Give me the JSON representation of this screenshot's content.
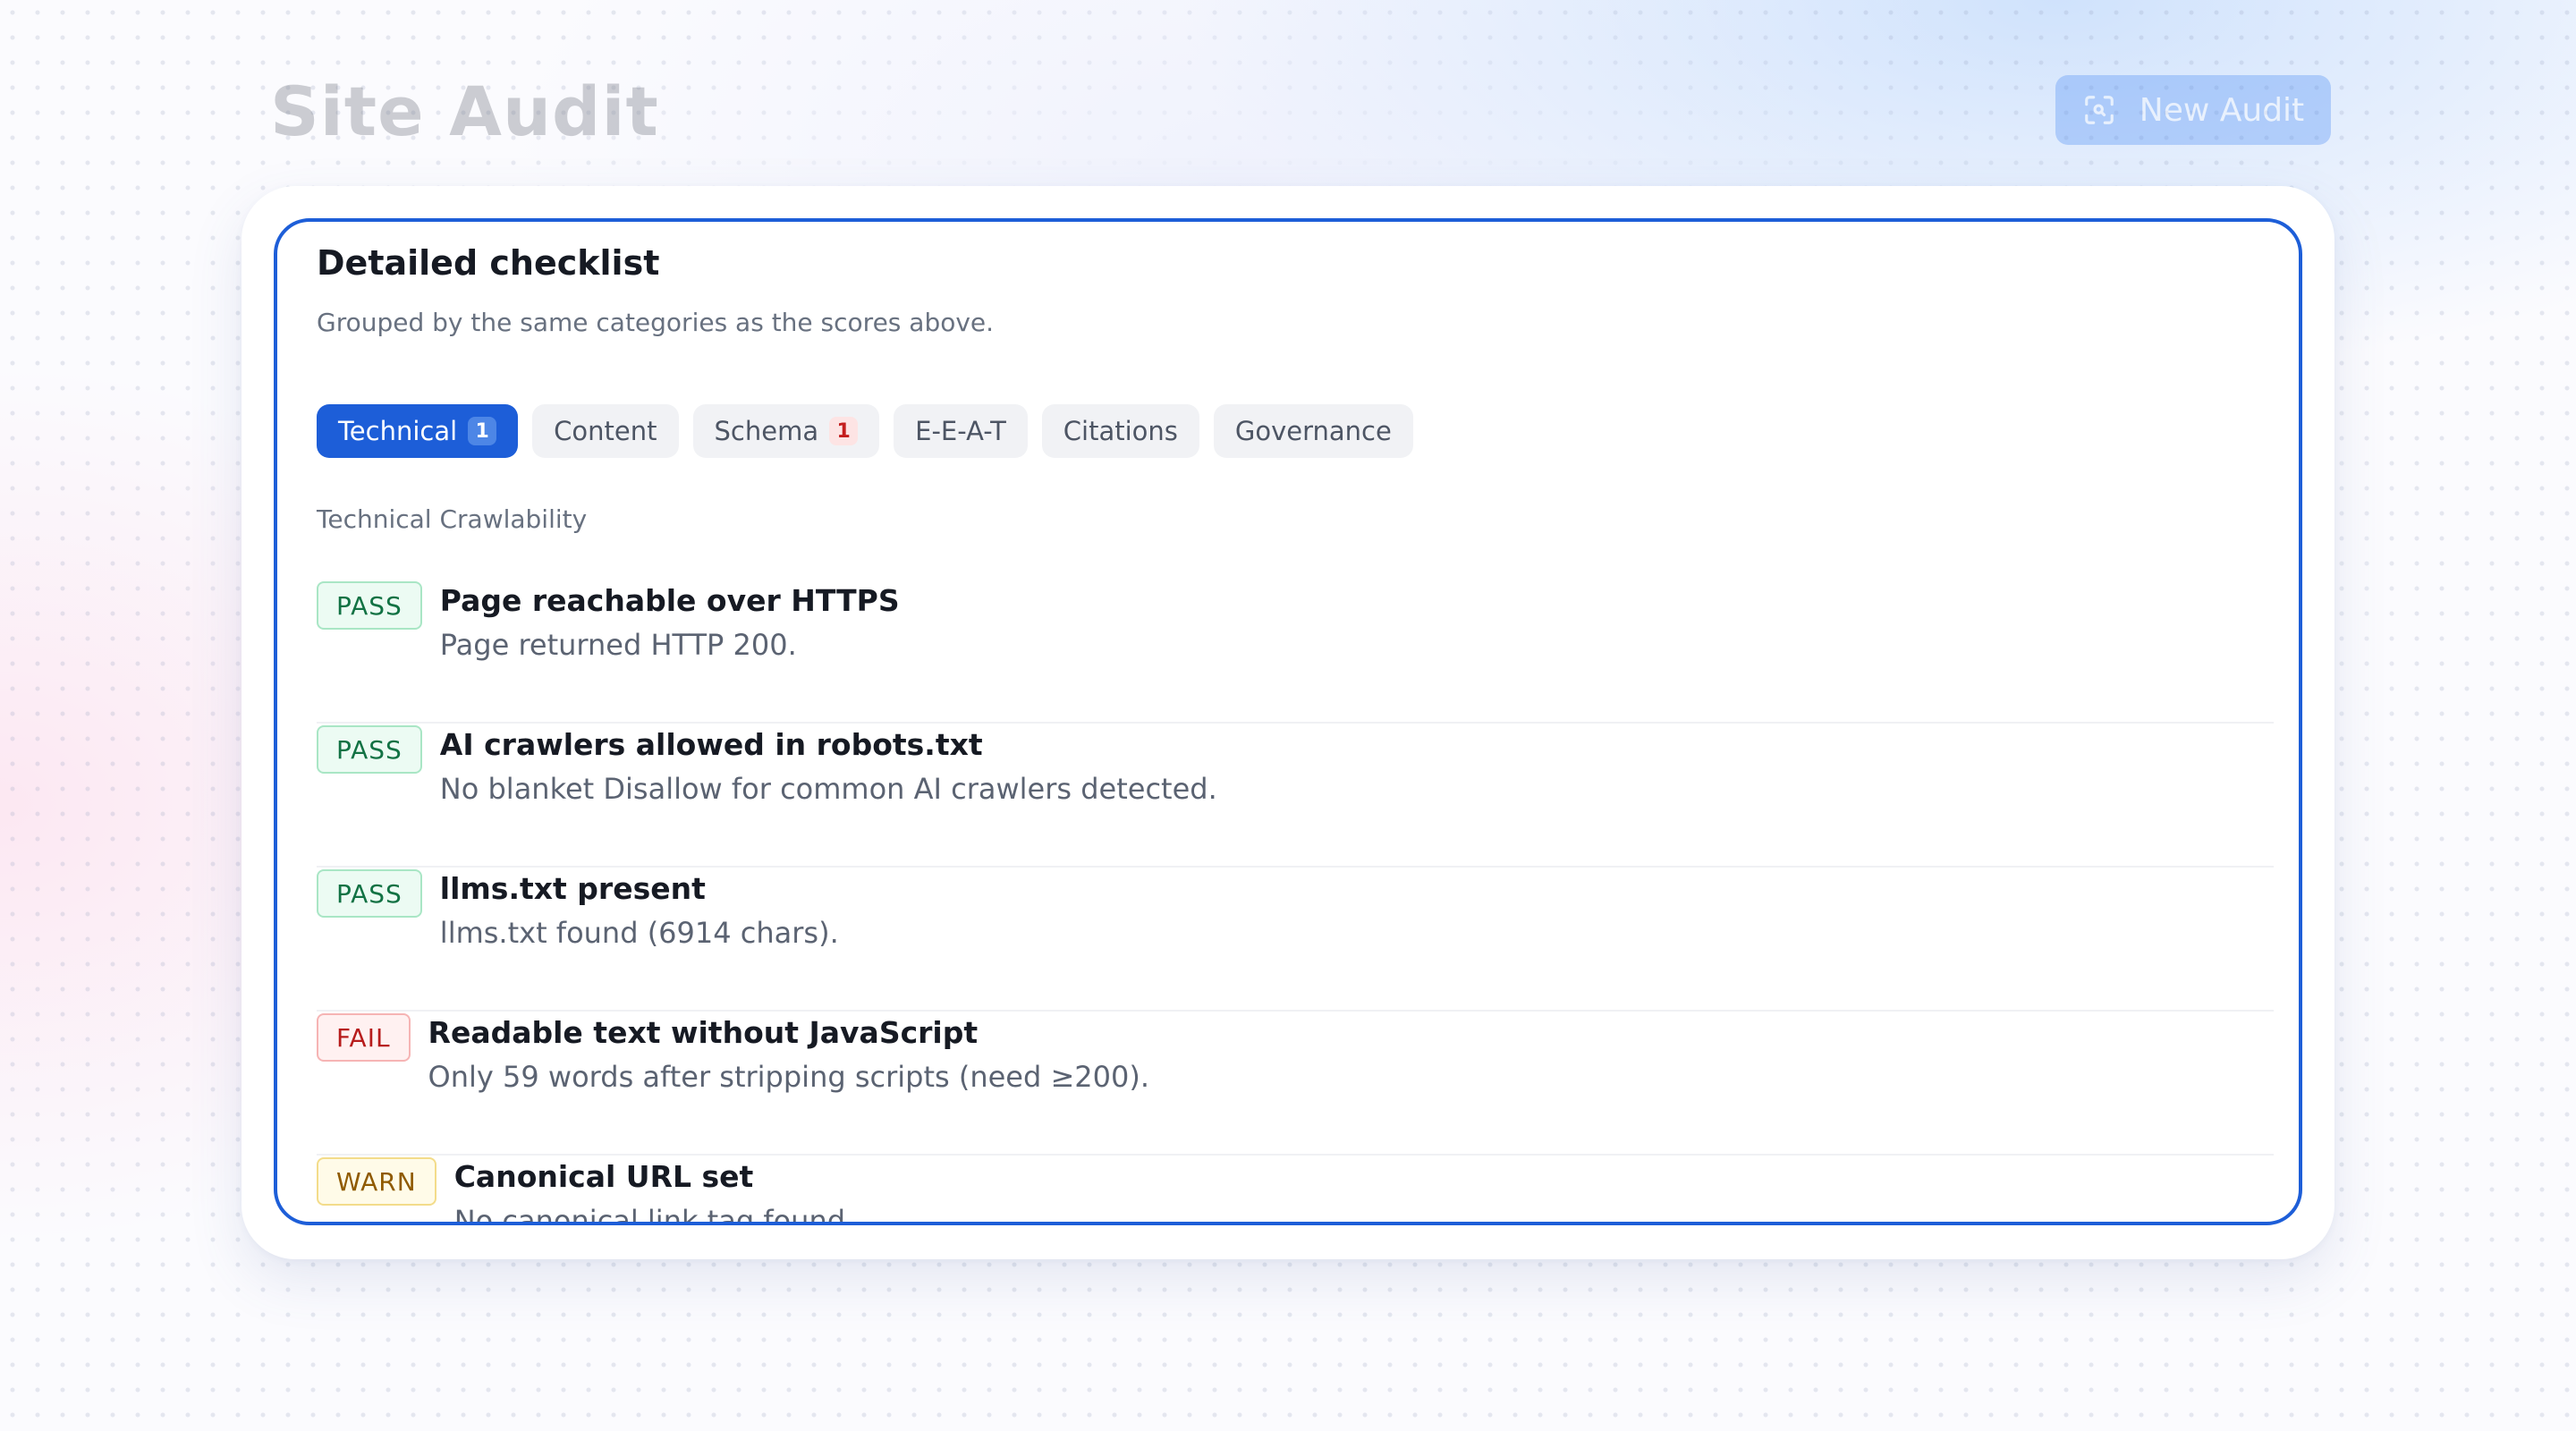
{
  "page": {
    "title": "Site Audit",
    "new_audit_label": "New Audit"
  },
  "checklist": {
    "title": "Detailed checklist",
    "subtitle": "Grouped by the same categories as the scores above.",
    "tabs": [
      {
        "label": "Technical",
        "badge": "1",
        "active": true
      },
      {
        "label": "Content",
        "badge": "",
        "active": false
      },
      {
        "label": "Schema",
        "badge": "1",
        "active": false
      },
      {
        "label": "E-E-A-T",
        "badge": "",
        "active": false
      },
      {
        "label": "Citations",
        "badge": "",
        "active": false
      },
      {
        "label": "Governance",
        "badge": "",
        "active": false
      }
    ],
    "section_label": "Technical Crawlability",
    "items": [
      {
        "status": "PASS",
        "title": "Page reachable over HTTPS",
        "description": "Page returned HTTP 200."
      },
      {
        "status": "PASS",
        "title": "AI crawlers allowed in robots.txt",
        "description": "No blanket Disallow for common AI crawlers detected."
      },
      {
        "status": "PASS",
        "title": "llms.txt present",
        "description": "llms.txt found (6914 chars)."
      },
      {
        "status": "FAIL",
        "title": "Readable text without JavaScript",
        "description": "Only 59 words after stripping scripts (need ≥200)."
      },
      {
        "status": "WARN",
        "title": "Canonical URL set",
        "description": "No canonical link tag found."
      }
    ]
  },
  "colors": {
    "accent": "#1d5ed8",
    "pass": "#127244",
    "fail": "#b71c1c",
    "warn": "#8f5a00"
  }
}
